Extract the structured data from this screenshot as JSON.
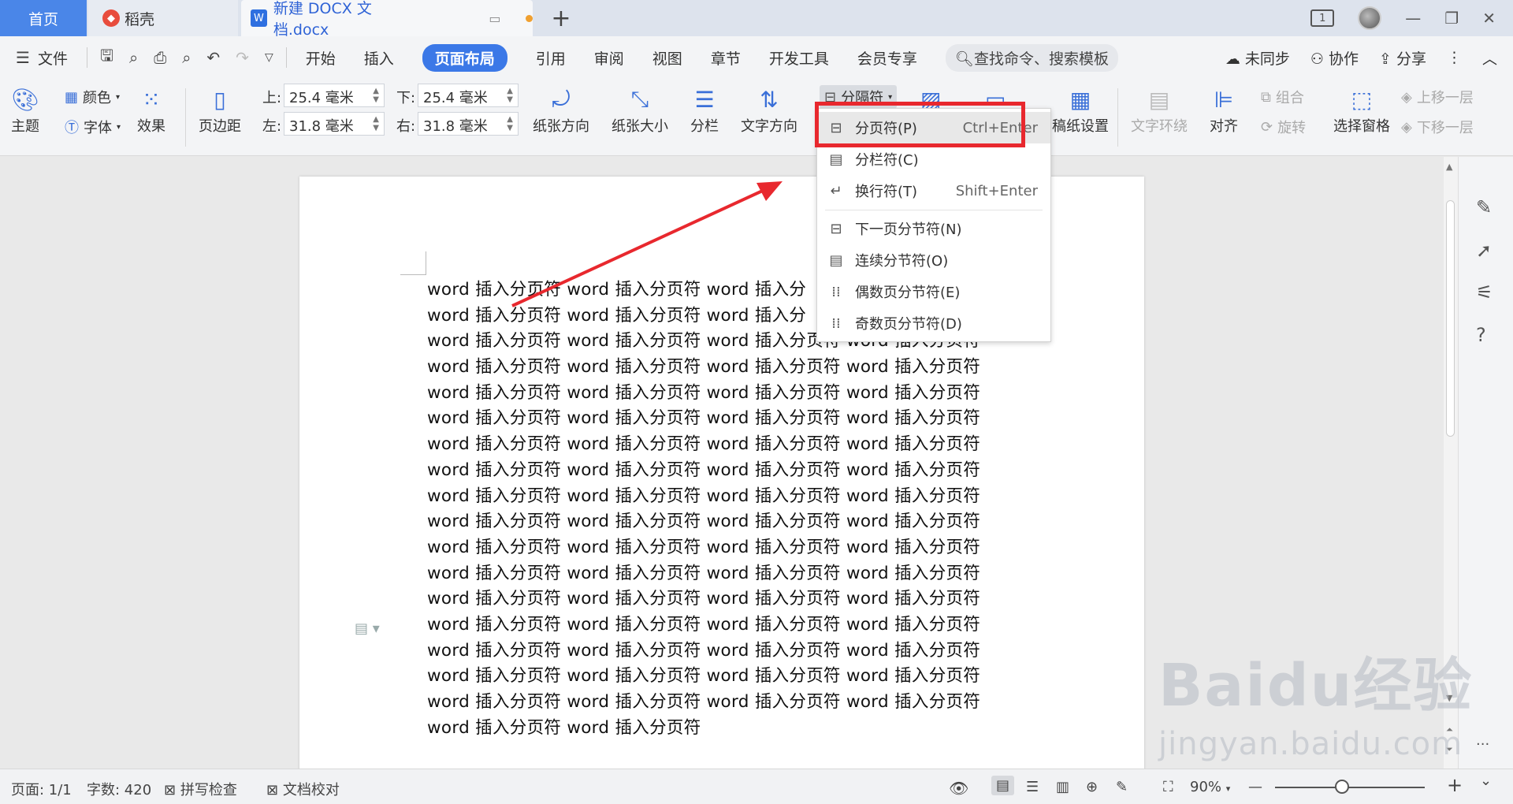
{
  "titlebar": {
    "tabs": [
      "首页",
      "稻壳",
      "新建 DOCX 文档.docx"
    ],
    "add": "+",
    "badge": "1",
    "restore": "❐",
    "minimize": "—",
    "maximize": "▢",
    "close": "✕"
  },
  "menubar": {
    "file": "文件",
    "items": [
      "开始",
      "插入",
      "页面布局",
      "引用",
      "审阅",
      "视图",
      "章节",
      "开发工具",
      "会员专享"
    ],
    "active": "页面布局",
    "search": "查找命令、搜索模板",
    "right": [
      "未同步",
      "协作",
      "分享"
    ],
    "more": "⋮",
    "collapse": "︿"
  },
  "ribbon": {
    "theme": "主题",
    "color": "颜色",
    "font": "字体",
    "effect": "效果",
    "margin": "页边距",
    "top_label": "上:",
    "bottom_label": "下:",
    "left_label": "左:",
    "right_label": "右:",
    "top_val": "25.4 毫米",
    "bottom_val": "25.4 毫米",
    "left_val": "31.8 毫米",
    "right_val": "31.8 毫米",
    "orientation": "纸张方向",
    "size": "纸张大小",
    "columns": "分栏",
    "text_direction": "文字方向",
    "breaks": "分隔符",
    "manuscript": "稿纸设置",
    "wrap": "文字环绕",
    "align": "对齐",
    "group": "组合",
    "rotate": "旋转",
    "select_pane": "选择窗格",
    "bring_forward": "上移一层",
    "send_backward": "下移一层"
  },
  "dropdown": {
    "items": [
      {
        "label": "分页符(P)",
        "shortcut": "Ctrl+Enter"
      },
      {
        "label": "分栏符(C)",
        "shortcut": ""
      },
      {
        "label": "换行符(T)",
        "shortcut": "Shift+Enter"
      },
      {
        "label": "下一页分节符(N)",
        "shortcut": ""
      },
      {
        "label": "连续分节符(O)",
        "shortcut": ""
      },
      {
        "label": "偶数页分节符(E)",
        "shortcut": ""
      },
      {
        "label": "奇数页分节符(D)",
        "shortcut": ""
      }
    ]
  },
  "document": {
    "lines": [
      "word 插入分页符 word 插入分页符 word 插入分",
      "word 插入分页符 word 插入分页符 word 插入分",
      "word 插入分页符 word 插入分页符 word 插入分页符 word 插入分页符",
      "word 插入分页符 word 插入分页符 word 插入分页符 word 插入分页符",
      "word 插入分页符 word 插入分页符 word 插入分页符 word 插入分页符",
      "word 插入分页符 word 插入分页符 word 插入分页符 word 插入分页符",
      "word 插入分页符 word 插入分页符 word 插入分页符 word 插入分页符",
      "word 插入分页符 word 插入分页符 word 插入分页符 word 插入分页符",
      "word 插入分页符 word 插入分页符 word 插入分页符 word 插入分页符",
      "word 插入分页符 word 插入分页符 word 插入分页符 word 插入分页符",
      "word 插入分页符 word 插入分页符 word 插入分页符 word 插入分页符",
      "word 插入分页符 word 插入分页符 word 插入分页符 word 插入分页符",
      "word 插入分页符 word 插入分页符 word 插入分页符 word 插入分页符",
      "word 插入分页符 word 插入分页符 word 插入分页符 word 插入分页符",
      "word 插入分页符 word 插入分页符 word 插入分页符 word 插入分页符",
      "word 插入分页符 word 插入分页符 word 插入分页符 word 插入分页符",
      "word 插入分页符 word 插入分页符 word 插入分页符 word 插入分页符",
      "word 插入分页符 word 插入分页符"
    ]
  },
  "statusbar": {
    "page": "页面: 1/1",
    "words": "字数: 420",
    "spell": "拼写检查",
    "proof": "文档校对",
    "zoom": "90%",
    "minus": "—",
    "plus": "+",
    "menu": "⌄"
  },
  "watermark": {
    "brand": "Baidu经验",
    "url": "jingyan.baidu.com"
  },
  "colors": {
    "accent": "#3b78e7",
    "highlight": "#e8282e"
  }
}
